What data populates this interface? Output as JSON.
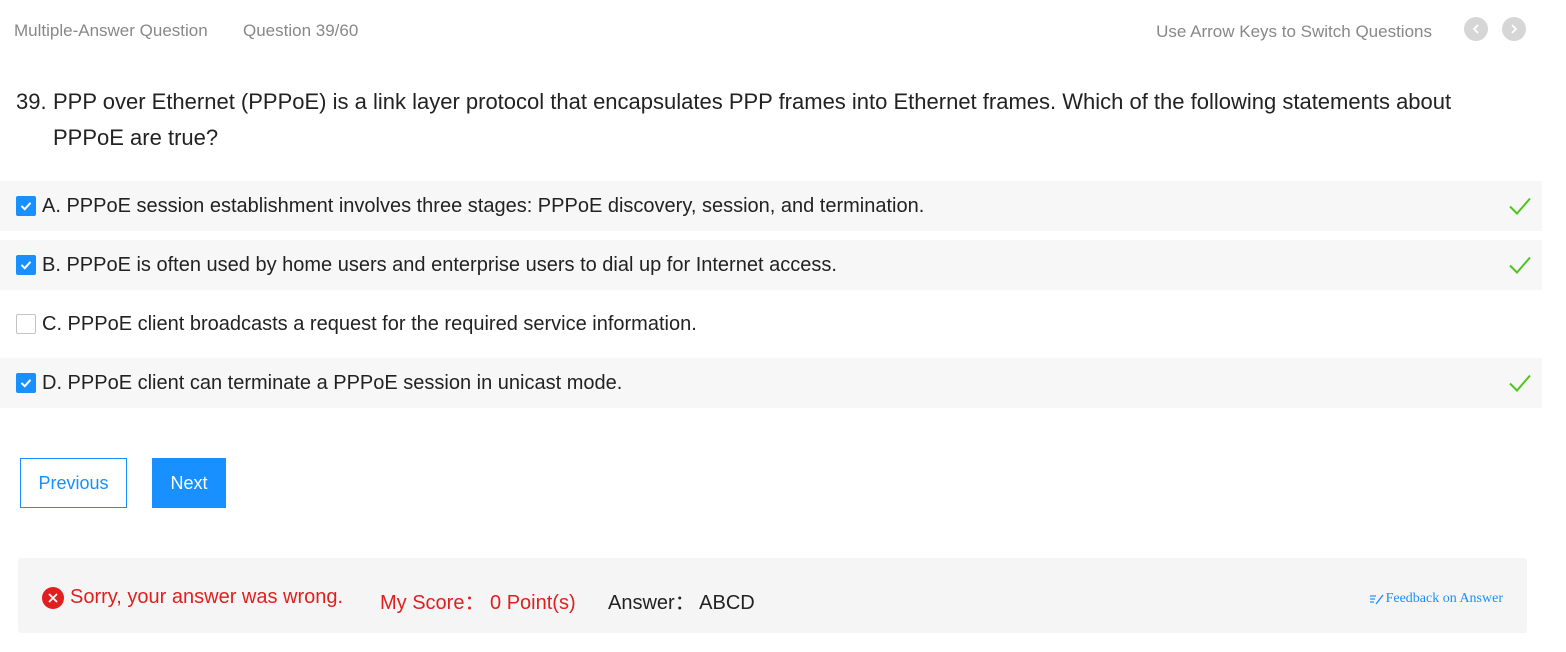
{
  "header": {
    "question_type": "Multiple-Answer Question",
    "question_counter": "Question 39/60",
    "hint": "Use Arrow Keys to Switch Questions",
    "prev_icon": "chevron-left-icon",
    "next_icon": "chevron-right-icon"
  },
  "question": {
    "number": "39.",
    "text": "PPP over Ethernet (PPPoE) is a link layer protocol that encapsulates PPP frames into Ethernet frames. Which of the following statements about PPPoE are true?"
  },
  "options": [
    {
      "label": "A. PPPoE session establishment involves three stages: PPPoE discovery, session, and termination.",
      "checked": true,
      "correct": true
    },
    {
      "label": "B. PPPoE is often used by home users and enterprise users to dial up for Internet access.",
      "checked": true,
      "correct": true
    },
    {
      "label": "C. PPPoE client broadcasts a request for the required service information.",
      "checked": false,
      "correct": false
    },
    {
      "label": "D. PPPoE client can terminate a PPPoE session in unicast mode.",
      "checked": true,
      "correct": true
    }
  ],
  "buttons": {
    "previous": "Previous",
    "next": "Next"
  },
  "result": {
    "status_text": "Sorry, your answer was wrong.",
    "score_text": "My Score： 0 Point(s)",
    "answer_text": "Answer： ABCD",
    "feedback_text": "Feedback on Answer"
  },
  "colors": {
    "accent": "#1890ff",
    "error": "#e02020",
    "correct": "#52c41a"
  }
}
